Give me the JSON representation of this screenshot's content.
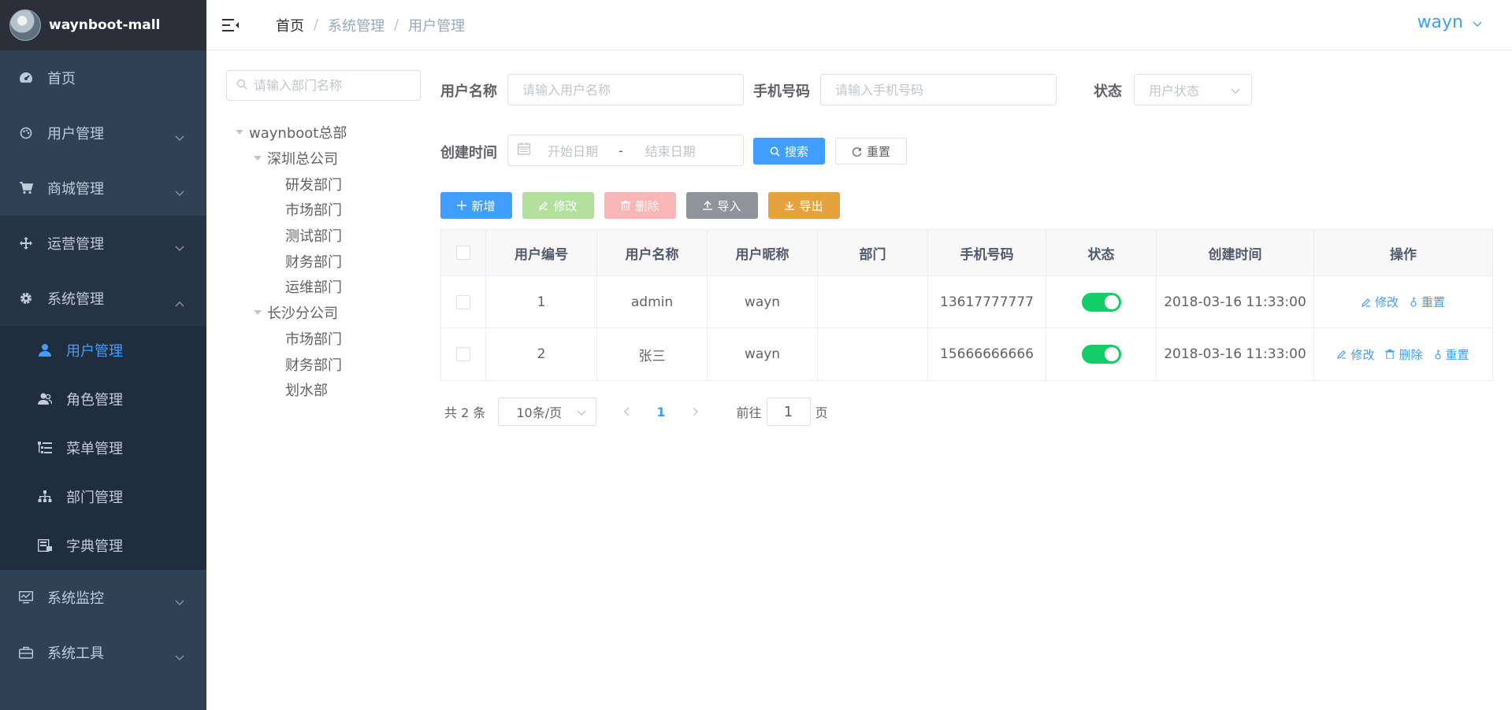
{
  "app": {
    "title": "waynboot-mall"
  },
  "sidebar": {
    "items": [
      {
        "label": "首页",
        "icon": "dashboard-icon"
      },
      {
        "label": "用户管理",
        "icon": "palette-icon"
      },
      {
        "label": "商城管理",
        "icon": "cart-icon"
      },
      {
        "label": "运营管理",
        "icon": "move-icon"
      },
      {
        "label": "系统管理",
        "icon": "gear-icon"
      }
    ],
    "system_sub": [
      {
        "label": "用户管理",
        "icon": "user-icon",
        "active": true
      },
      {
        "label": "角色管理",
        "icon": "peoples-icon"
      },
      {
        "label": "菜单管理",
        "icon": "tree-table-icon"
      },
      {
        "label": "部门管理",
        "icon": "org-tree-icon"
      },
      {
        "label": "字典管理",
        "icon": "dict-icon"
      }
    ],
    "bottom": [
      {
        "label": "系统监控",
        "icon": "monitor-icon"
      },
      {
        "label": "系统工具",
        "icon": "toolbox-icon"
      }
    ]
  },
  "header": {
    "breadcrumb": [
      "首页",
      "系统管理",
      "用户管理"
    ],
    "separator": "/",
    "user": "wayn"
  },
  "dept_tree": {
    "search_placeholder": "请输入部门名称",
    "nodes": [
      {
        "label": "waynboot总部",
        "level": 1,
        "expanded": true
      },
      {
        "label": "深圳总公司",
        "level": 2,
        "expanded": true
      },
      {
        "label": "研发部门",
        "level": 3
      },
      {
        "label": "市场部门",
        "level": 3
      },
      {
        "label": "测试部门",
        "level": 3
      },
      {
        "label": "财务部门",
        "level": 3
      },
      {
        "label": "运维部门",
        "level": 3
      },
      {
        "label": "长沙分公司",
        "level": 2,
        "expanded": true
      },
      {
        "label": "市场部门",
        "level": 3
      },
      {
        "label": "财务部门",
        "level": 3
      },
      {
        "label": "划水部",
        "level": 3
      }
    ]
  },
  "search": {
    "username_label": "用户名称",
    "username_placeholder": "请输入用户名称",
    "phone_label": "手机号码",
    "phone_placeholder": "请输入手机号码",
    "status_label": "状态",
    "status_placeholder": "用户状态",
    "created_label": "创建时间",
    "start_placeholder": "开始日期",
    "date_separator": "-",
    "end_placeholder": "结束日期",
    "search_button": "搜索",
    "reset_button": "重置"
  },
  "toolbar": {
    "add": "新增",
    "edit": "修改",
    "delete": "删除",
    "import": "导入",
    "export": "导出"
  },
  "table": {
    "columns": [
      "用户编号",
      "用户名称",
      "用户昵称",
      "部门",
      "手机号码",
      "状态",
      "创建时间",
      "操作"
    ],
    "rows": [
      {
        "id": "1",
        "username": "admin",
        "nickname": "wayn",
        "dept": "",
        "phone": "13617777777",
        "status_on": true,
        "created": "2018-03-16 11:33:00",
        "actions": [
          "修改",
          "重置"
        ]
      },
      {
        "id": "2",
        "username": "张三",
        "nickname": "wayn",
        "dept": "",
        "phone": "15666666666",
        "status_on": true,
        "created": "2018-03-16 11:33:00",
        "actions": [
          "修改",
          "删除",
          "重置"
        ]
      }
    ]
  },
  "pagination": {
    "total_text": "共 2 条",
    "page_size": "10条/页",
    "current_page": "1",
    "goto_prefix": "前往",
    "goto_value": "1",
    "goto_suffix": "页"
  },
  "colors": {
    "sidebar_bg": "#304156",
    "logo_bg": "#2b2f3a",
    "submenu_bg": "#1f2d3d",
    "primary": "#409eff",
    "success": "#13ce66",
    "warning": "#e6a23c"
  }
}
